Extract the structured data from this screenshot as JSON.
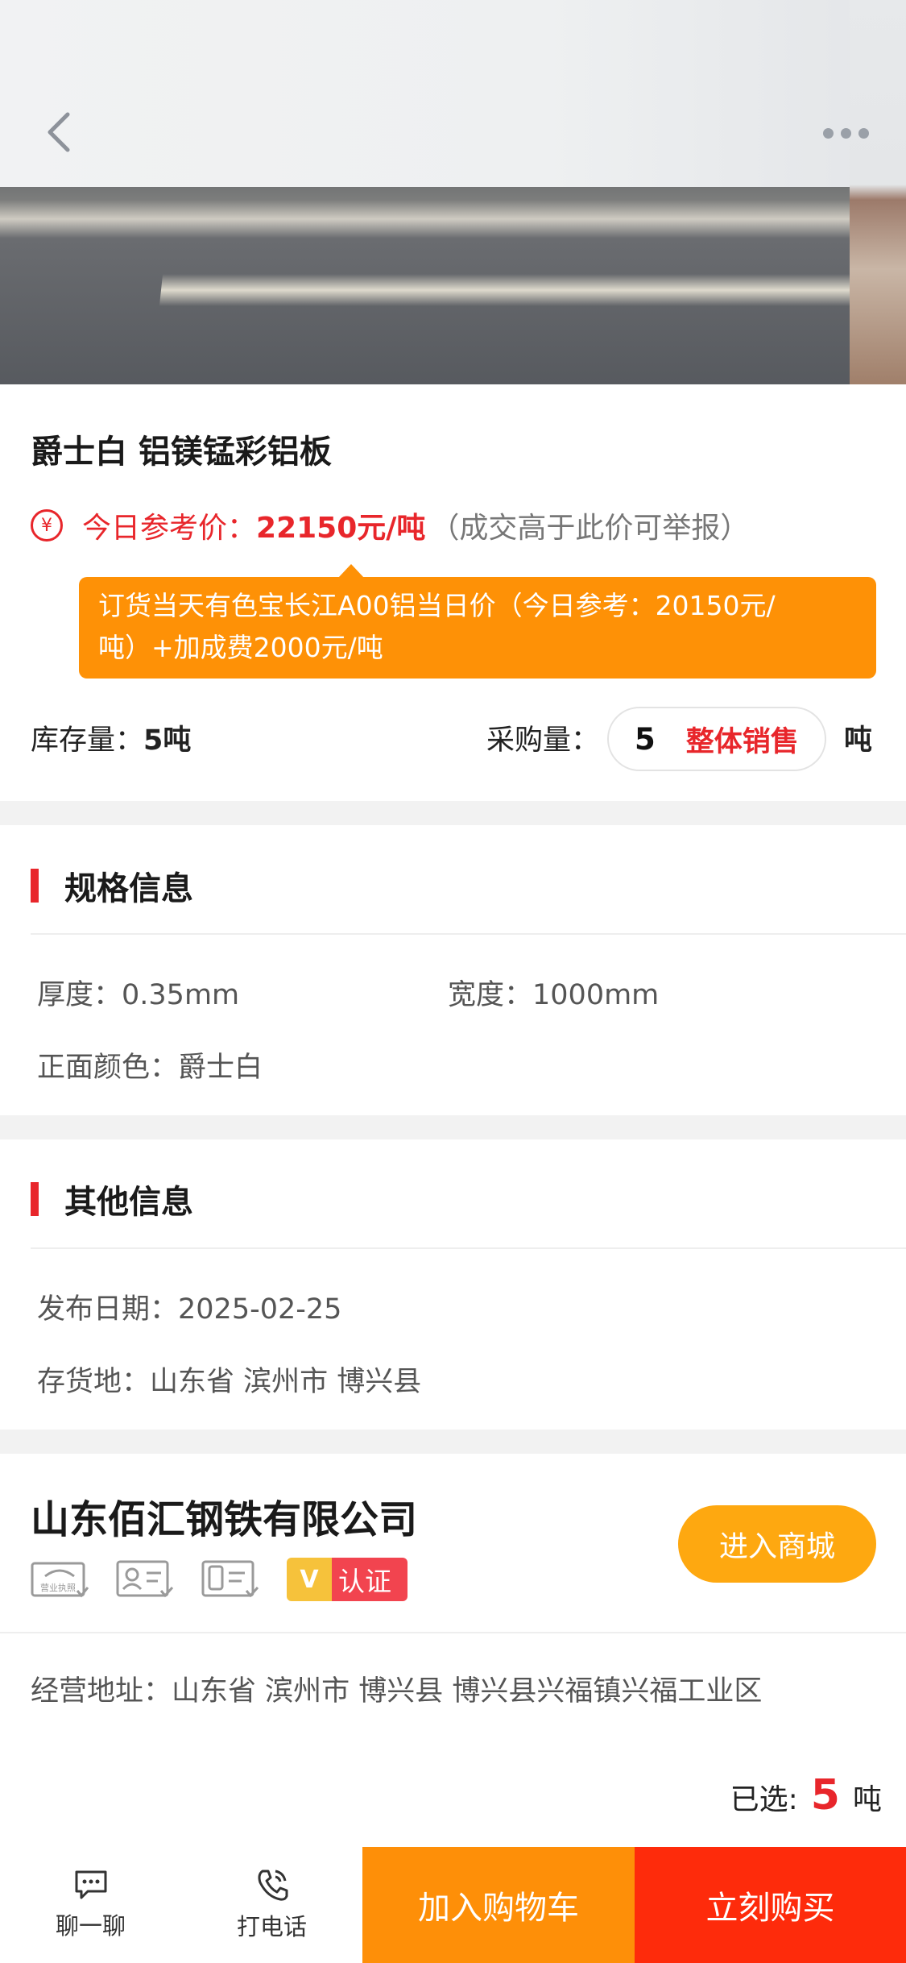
{
  "nav": {
    "back_icon": "chevron-left-icon",
    "more_icon": "more-dots-icon"
  },
  "product": {
    "title": "爵士白 铝镁锰彩铝板",
    "price_label": "今日参考价：",
    "price_value": "22150元/吨",
    "price_note": "（成交高于此价可举报）",
    "tip_line1": "订货当天有色宝长江A00铝当日价（今日参考：20150元/",
    "tip_line2": "吨）+加成费2000元/吨",
    "stock_label": "库存量：",
    "stock_value": "5吨",
    "purchase_label": "采购量：",
    "purchase_qty": "5",
    "whole_sale": "整体销售",
    "unit": "吨"
  },
  "spec": {
    "title": "规格信息",
    "thickness_label": "厚度：",
    "thickness_value": "0.35mm",
    "width_label": "宽度：",
    "width_value": "1000mm",
    "color_label": "正面颜色：",
    "color_value": "爵士白"
  },
  "other": {
    "title": "其他信息",
    "date_label": "发布日期：",
    "date_value": "2025-02-25",
    "location_label": "存货地：",
    "location_value": "山东省 滨州市 博兴县"
  },
  "company": {
    "name": "山东佰汇钢铁有限公司",
    "license_text": "营业执照",
    "cert_v": "V",
    "cert_text": "认证",
    "shop_button": "进入商城",
    "address_label": "经营地址：",
    "address_value": "山东省 滨州市 博兴县 博兴县兴福镇兴福工业区"
  },
  "selection": {
    "label": "已选:",
    "count": "5",
    "unit": "吨"
  },
  "bottom": {
    "chat_label": "聊一聊",
    "call_label": "打电话",
    "cart_button": "加入购物车",
    "buy_button": "立刻购买"
  },
  "colors": {
    "accent_red": "#e8262b",
    "orange": "#fe9106",
    "buy_red": "#fe2b0b"
  }
}
